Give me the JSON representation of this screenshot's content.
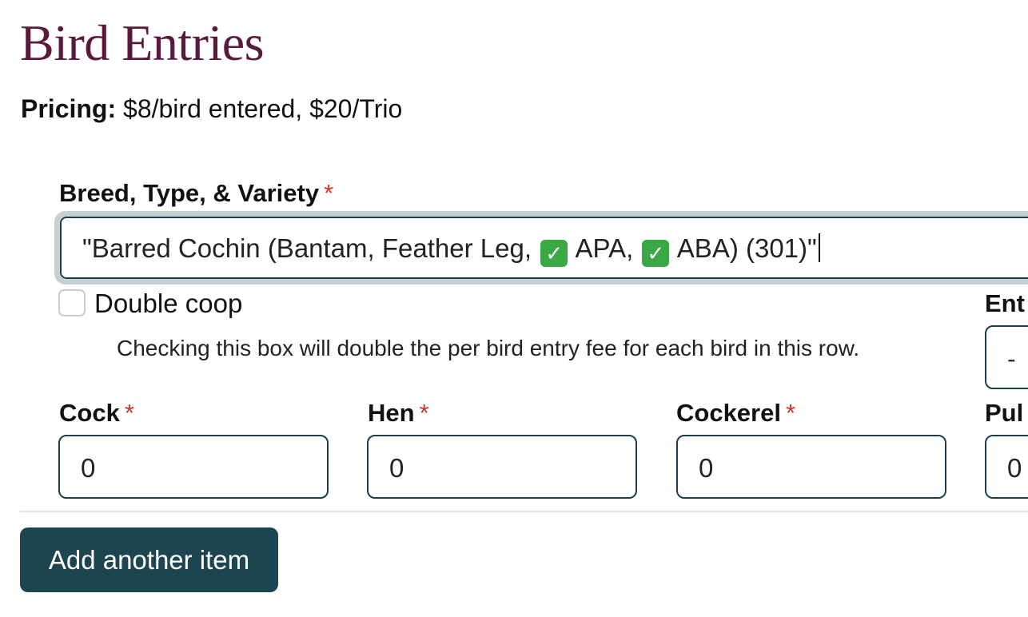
{
  "page": {
    "title": "Bird Entries",
    "pricing_label": "Pricing:",
    "pricing_text": "$8/bird entered, $20/Trio"
  },
  "form": {
    "required_marker": "*",
    "breed": {
      "label": "Breed, Type, & Variety",
      "value_parts": [
        "\"Barred Cochin (Bantam, Feather Leg, ",
        " APA, ",
        " ABA) (301)\""
      ],
      "badge_icon": "check-mark-button-icon"
    },
    "double_coop": {
      "label": "Double coop",
      "checked": false,
      "help": "Checking this box will double the per bird entry fee for each bird in this row."
    },
    "entry_type": {
      "label": "Ent",
      "value": "-  "
    },
    "cock": {
      "label": "Cock",
      "value": "0"
    },
    "hen": {
      "label": "Hen",
      "value": "0"
    },
    "cockerel": {
      "label": "Cockerel",
      "value": "0"
    },
    "pullet": {
      "label": "Pul",
      "value": "0"
    }
  },
  "actions": {
    "add_item_label": "Add another item"
  },
  "colors": {
    "title": "#5a1a3c",
    "required": "#d0342c",
    "button_bg": "#1c4550",
    "input_border": "#1e3f4a",
    "focus_ring": "#c5d0d3",
    "check_emoji": "#39a845"
  }
}
